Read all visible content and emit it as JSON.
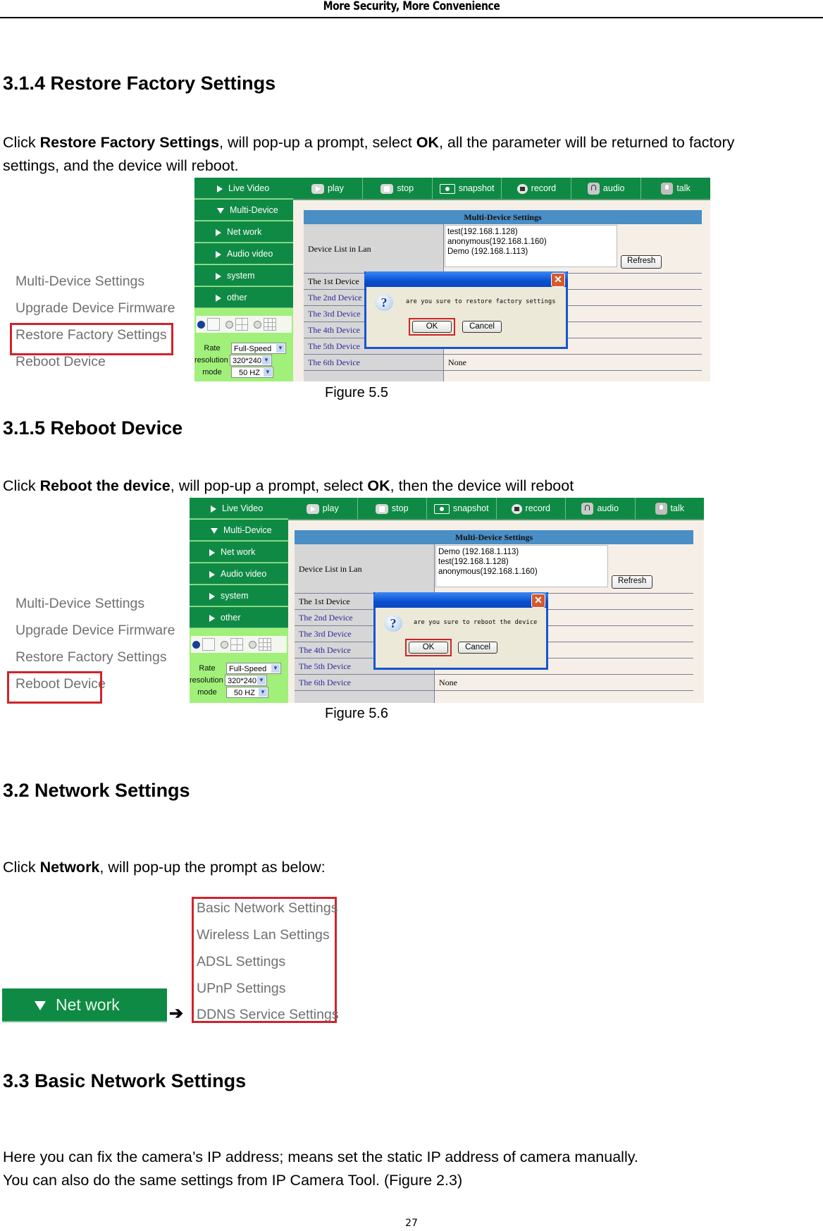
{
  "running_header": "More Security, More Convenience",
  "sections": {
    "restore": {
      "heading": "3.1.4 Restore Factory Settings",
      "para_prefix": "Click ",
      "para_bold1": "Restore Factory Settings",
      "para_mid": ", will pop-up a prompt, select ",
      "para_bold2": "OK",
      "para_suffix": ", all the parameter will be returned to factory",
      "para_line2": "settings, and the device will reboot.",
      "caption": "Figure 5.5"
    },
    "reboot": {
      "heading": "3.1.5 Reboot Device",
      "para_prefix": "Click ",
      "para_bold1": "Reboot the device",
      "para_mid": ", will pop-up a prompt, select ",
      "para_bold2": "OK",
      "para_suffix": ", then the device will reboot",
      "caption": "Figure 5.6"
    },
    "network": {
      "heading": "3.2 Network Settings",
      "para_prefix": "Click ",
      "para_bold1": "Network",
      "para_suffix": ", will pop-up the prompt as below:",
      "nav_label": "Net work",
      "menu_items": [
        "Basic Network Settings",
        "Wireless Lan Settings",
        "ADSL Settings",
        "UPnP Settings",
        "DDNS Service Settings"
      ]
    },
    "basic": {
      "heading": "3.3 Basic Network Settings",
      "line1": "Here you can fix the camera’s IP address; means set the static IP address of camera manually.",
      "line2": "You can also do the same settings from IP Camera Tool. (Figure 2.3)"
    }
  },
  "other_menu": [
    "Multi-Device Settings",
    "Upgrade Device Firmware",
    "Restore Factory Settings",
    "Reboot Device"
  ],
  "camera_ui": {
    "nav": [
      "Live Video",
      "Multi-Device",
      "Net work",
      "Audio video",
      "system",
      "other"
    ],
    "toolbar": [
      "play",
      "stop",
      "snapshot",
      "record",
      "audio",
      "talk"
    ],
    "controls": {
      "rate_label": "Rate",
      "rate_value": "Full-Speed",
      "resolution_label": "resolution",
      "resolution_value": "320*240",
      "mode_label": "mode",
      "mode_value": "50 HZ"
    },
    "table_title": "Multi-Device Settings",
    "device_list_label": "Device List in Lan",
    "refresh": "Refresh",
    "devices": [
      "The 1st Device",
      "The 2nd Device",
      "The 3rd Device",
      "The 4th Device",
      "The 5th Device",
      "The 6th Device"
    ],
    "none": "None",
    "ok": "OK",
    "cancel": "Cancel"
  },
  "fig55": {
    "device_list": [
      "test(192.168.1.128)",
      "anonymous(192.168.1.160)",
      "Demo (192.168.1.113)"
    ],
    "dialog_msg": "are you sure to restore factory settings"
  },
  "fig56": {
    "device_list": [
      "Demo (192.168.1.113)",
      "test(192.168.1.128)",
      "anonymous(192.168.1.160)"
    ],
    "dialog_msg": "are you sure to reboot the device"
  },
  "page_number": "27"
}
